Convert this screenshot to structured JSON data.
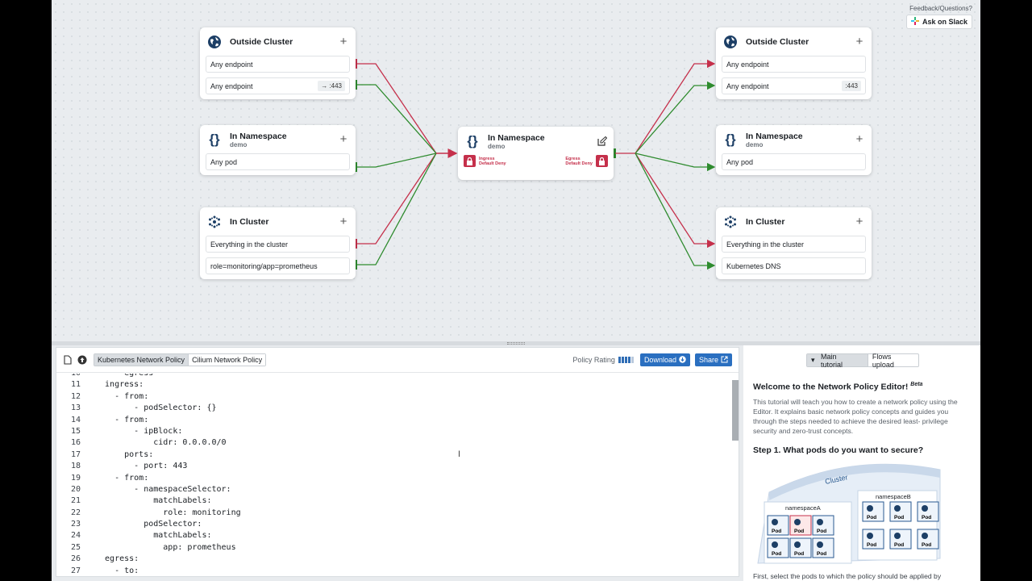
{
  "top_links": {
    "feedback": "Feedback/Questions?",
    "slack": "Ask on Slack"
  },
  "ingress": [
    {
      "title": "Outside Cluster",
      "icon": "globe-icon",
      "rows": [
        {
          "label": "Any endpoint",
          "tag": ""
        },
        {
          "label": "Any endpoint",
          "tag": "→ :443"
        }
      ]
    },
    {
      "title": "In Namespace",
      "subtitle": "demo",
      "icon": "braces-icon",
      "rows": [
        {
          "label": "Any pod",
          "tag": ""
        }
      ]
    },
    {
      "title": "In Cluster",
      "icon": "cluster-icon",
      "rows": [
        {
          "label": "Everything in the cluster",
          "tag": ""
        },
        {
          "label": "role=monitoring/app=prometheus",
          "tag": ""
        }
      ]
    }
  ],
  "center": {
    "title": "In Namespace",
    "subtitle": "demo",
    "ingress_label": "Ingress",
    "ingress_sub": "Default Deny",
    "egress_label": "Egress",
    "egress_sub": "Default Deny"
  },
  "egress": [
    {
      "title": "Outside Cluster",
      "icon": "globe-icon",
      "rows": [
        {
          "label": "Any endpoint",
          "tag": ""
        },
        {
          "label": "Any endpoint",
          "tag": ":443"
        }
      ]
    },
    {
      "title": "In Namespace",
      "subtitle": "demo",
      "icon": "braces-icon",
      "rows": [
        {
          "label": "Any pod",
          "tag": ""
        }
      ]
    },
    {
      "title": "In Cluster",
      "icon": "cluster-icon",
      "rows": [
        {
          "label": "Everything in the cluster",
          "tag": ""
        },
        {
          "label": "Kubernetes DNS",
          "tag": ""
        }
      ]
    }
  ],
  "colors": {
    "deny": "#c5304b",
    "allow": "#2e8b2e",
    "accent": "#2a6fc0"
  },
  "toolbar": {
    "policy_tabs": [
      "Kubernetes Network Policy",
      "Cilium Network Policy"
    ],
    "rating_label": "Policy Rating",
    "rating_level": "4/5",
    "download": "Download",
    "share": "Share"
  },
  "code": [
    {
      "n": "10",
      "t": "    - egress"
    },
    {
      "n": "11",
      "t": "  ingress:"
    },
    {
      "n": "12",
      "t": "    - from:"
    },
    {
      "n": "13",
      "t": "        - podSelector: {}"
    },
    {
      "n": "14",
      "t": "    - from:"
    },
    {
      "n": "15",
      "t": "        - ipBlock:"
    },
    {
      "n": "16",
      "t": "            cidr: 0.0.0.0/0"
    },
    {
      "n": "17",
      "t": "      ports:"
    },
    {
      "n": "18",
      "t": "        - port: 443"
    },
    {
      "n": "19",
      "t": "    - from:"
    },
    {
      "n": "20",
      "t": "        - namespaceSelector:"
    },
    {
      "n": "21",
      "t": "            matchLabels:"
    },
    {
      "n": "22",
      "t": "              role: monitoring"
    },
    {
      "n": "23",
      "t": "          podSelector:"
    },
    {
      "n": "24",
      "t": "            matchLabels:"
    },
    {
      "n": "25",
      "t": "              app: prometheus"
    },
    {
      "n": "26",
      "t": "  egress:"
    },
    {
      "n": "27",
      "t": "    - to:"
    }
  ],
  "tutorial": {
    "tabs": [
      "Main tutorial",
      "Flows upload"
    ],
    "title": "Welcome to the Network Policy Editor!",
    "beta": "Beta",
    "body": "This tutorial will teach you how to create a network policy using the Editor. It explains basic network policy concepts and guides you through the steps needed to achieve the desired least- privilege security and zero-trust concepts.",
    "step1": "Step 1. What pods do you want to secure?",
    "illus_cluster": "Cluster",
    "illus_ns_a": "namespaceA",
    "illus_ns_b": "namespaceB",
    "pod_label": "Pod",
    "footer": "First, select the pods to which the policy should be applied by"
  }
}
